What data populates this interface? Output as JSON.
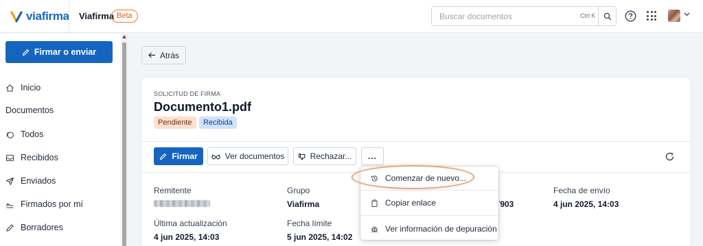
{
  "header": {
    "logo_text": "viafirma",
    "app_name": "Viafirma",
    "beta_label": "Beta",
    "search": {
      "placeholder": "Buscar documentos",
      "shortcut": "Ctrl K"
    }
  },
  "sidebar": {
    "primary_action": "Firmar o enviar",
    "home": "Inicio",
    "section_documents": "Documentos",
    "items": [
      {
        "label": "Todos",
        "icon": "copy-icon"
      },
      {
        "label": "Recibidos",
        "icon": "inbox-icon"
      },
      {
        "label": "Enviados",
        "icon": "send-icon"
      },
      {
        "label": "Firmados por mí",
        "icon": "signature-icon"
      },
      {
        "label": "Borradores",
        "icon": "pencil-icon"
      }
    ]
  },
  "main": {
    "back_label": "Atrás",
    "card": {
      "eyebrow": "SOLICITUD DE FIRMA",
      "title": "Documento1.pdf",
      "badges": [
        "Pendiente",
        "Recibida"
      ],
      "actions": {
        "sign": "Firmar",
        "view_docs": "Ver documentos",
        "reject": "Rechazar...",
        "more": "..."
      },
      "fields": {
        "sender_label": "Remitente",
        "group_label": "Grupo",
        "group_value": "Viafirma",
        "id_value_partial": "T903",
        "sent_label": "Fecha de envío",
        "sent_value": "4 jun 2025, 14:03",
        "updated_label": "Última actualización",
        "updated_value": "4 jun 2025, 14:03",
        "deadline_label": "Fecha límite",
        "deadline_value": "5 jun 2025, 14:02"
      }
    },
    "menu": {
      "items": [
        {
          "label": "Comenzar de nuevo...",
          "icon": "history-icon"
        },
        {
          "label": "Copiar enlace",
          "icon": "clipboard-icon"
        },
        {
          "label": "Ver información de depuración",
          "icon": "bug-icon"
        }
      ]
    }
  },
  "colors": {
    "brand": "#1565c0",
    "accent_orange": "#f97316",
    "highlight": "#e3a77a"
  }
}
